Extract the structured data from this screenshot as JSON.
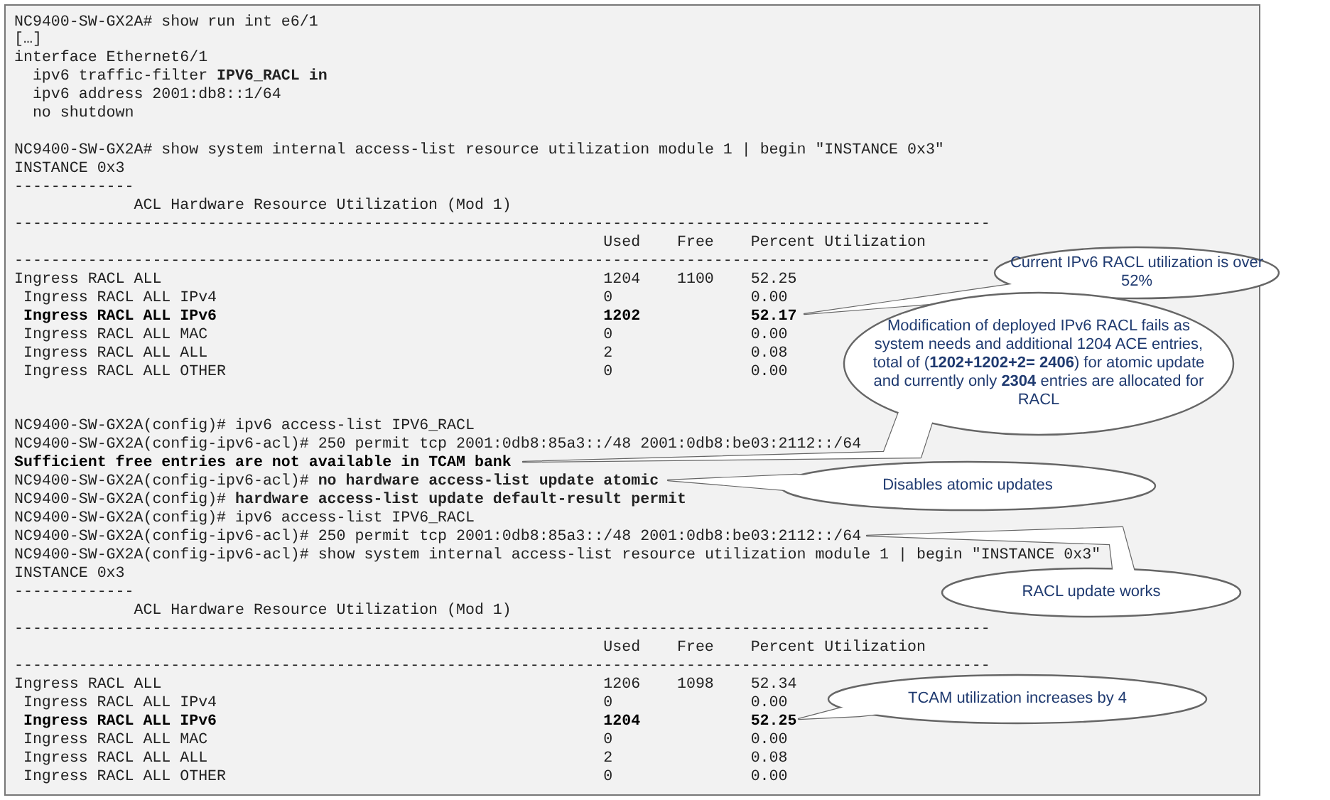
{
  "terminal": {
    "blocks": [
      {
        "kind": "line",
        "text": "NC9400-SW-GX2A# show run int e6/1",
        "bold": false
      },
      {
        "kind": "line",
        "text": "[…]",
        "bold": false
      },
      {
        "kind": "line",
        "text": "interface Ethernet6/1",
        "bold": false,
        "children": [
          {
            "kind": "line",
            "text": "ipv6 traffic-filter **IPV6_RACL in**",
            "bold": false
          },
          {
            "kind": "line",
            "text": "ipv6 address 2001:db8::1/64",
            "bold": false
          },
          {
            "kind": "line",
            "text": "no shutdown",
            "bold": false
          }
        ]
      },
      {
        "kind": "blank"
      },
      {
        "kind": "line",
        "text": "NC9400-SW-GX2A# show system internal access-list resource utilization module 1 | begin \"INSTANCE 0x3\"",
        "bold": false
      },
      {
        "kind": "line",
        "text": "INSTANCE 0x3",
        "bold": false
      },
      {
        "kind": "rule",
        "text": "-------------"
      },
      {
        "kind": "heading",
        "text": "ACL Hardware Resource Utilization (Mod 1)"
      },
      {
        "kind": "table",
        "rule_above": "----------------------------------------------------------------------------------------------------------",
        "rule_below": "----------------------------------------------------------------------------------------------------------",
        "columns": [
          "Used",
          "Free",
          "Percent Utilization"
        ],
        "rows": [
          {
            "label": "Ingress RACL ALL",
            "used": "1204",
            "free": "1100",
            "percent": "52.25",
            "bold": false,
            "children": [
              {
                "label": "Ingress RACL ALL IPv4",
                "used": "0",
                "percent": "0.00",
                "bold": false
              },
              {
                "label": "Ingress RACL ALL IPv6",
                "used": "1202",
                "percent": "52.17",
                "bold": true
              },
              {
                "label": "Ingress RACL ALL MAC",
                "used": "0",
                "percent": "0.00",
                "bold": false
              },
              {
                "label": "Ingress RACL ALL ALL",
                "used": "2",
                "percent": "0.08",
                "bold": false
              },
              {
                "label": "Ingress RACL ALL OTHER",
                "used": "0",
                "percent": "0.00",
                "bold": false
              }
            ]
          }
        ]
      },
      {
        "kind": "blank"
      },
      {
        "kind": "blank"
      },
      {
        "kind": "line",
        "text": "NC9400-SW-GX2A(config)# ipv6 access-list IPV6_RACL",
        "bold": false
      },
      {
        "kind": "line",
        "text": "NC9400-SW-GX2A(config-ipv6-acl)# 250 permit tcp 2001:0db8:85a3::/48 2001:0db8:be03:2112::/64",
        "bold": false
      },
      {
        "kind": "line",
        "text": "Sufficient free entries are not available in TCAM bank",
        "bold": true
      },
      {
        "kind": "line",
        "text": "NC9400-SW-GX2A(config-ipv6-acl)# **no hardware access-list update atomic**",
        "bold": false
      },
      {
        "kind": "line",
        "text": "NC9400-SW-GX2A(config)# **hardware access-list update default-result permit**",
        "bold": false
      },
      {
        "kind": "line",
        "text": "NC9400-SW-GX2A(config)# ipv6 access-list IPV6_RACL",
        "bold": false
      },
      {
        "kind": "line",
        "text": "NC9400-SW-GX2A(config-ipv6-acl)# 250 permit tcp 2001:0db8:85a3::/48 2001:0db8:be03:2112::/64",
        "bold": false
      },
      {
        "kind": "line",
        "text": "NC9400-SW-GX2A(config-ipv6-acl)# show system internal access-list resource utilization module 1 | begin \"INSTANCE 0x3\"",
        "bold": false
      },
      {
        "kind": "line",
        "text": "INSTANCE 0x3",
        "bold": false
      },
      {
        "kind": "rule",
        "text": "-------------"
      },
      {
        "kind": "heading",
        "text": "ACL Hardware Resource Utilization (Mod 1)"
      },
      {
        "kind": "table",
        "rule_above": "----------------------------------------------------------------------------------------------------------",
        "rule_below": "----------------------------------------------------------------------------------------------------------",
        "columns": [
          "Used",
          "Free",
          "Percent Utilization"
        ],
        "rows": [
          {
            "label": "Ingress RACL ALL",
            "used": "1206",
            "free": "1098",
            "percent": "52.34",
            "bold": false,
            "children": [
              {
                "label": "Ingress RACL ALL IPv4",
                "used": "0",
                "percent": "0.00",
                "bold": false
              },
              {
                "label": "Ingress RACL ALL IPv6",
                "used": "1204",
                "percent": "52.25",
                "bold": true
              },
              {
                "label": "Ingress RACL ALL MAC",
                "used": "0",
                "percent": "0.00",
                "bold": false
              },
              {
                "label": "Ingress RACL ALL ALL",
                "used": "2",
                "percent": "0.08",
                "bold": false
              },
              {
                "label": "Ingress RACL ALL OTHER",
                "used": "0",
                "percent": "0.00",
                "bold": false
              }
            ]
          }
        ]
      }
    ]
  },
  "callouts": [
    {
      "text": "Current IPv6 RACL utilization is over 52%"
    },
    {
      "text": "Modification of deployed IPv6 RACL fails as system needs and additional 1204 ACE entries, total of (**1202+1202+2= 2406**) for atomic update and currently only **2304** entries are allocated for RACL"
    },
    {
      "text": "Disables atomic updates"
    },
    {
      "text": "RACL update works"
    },
    {
      "text": "TCAM utilization increases by 4"
    }
  ]
}
